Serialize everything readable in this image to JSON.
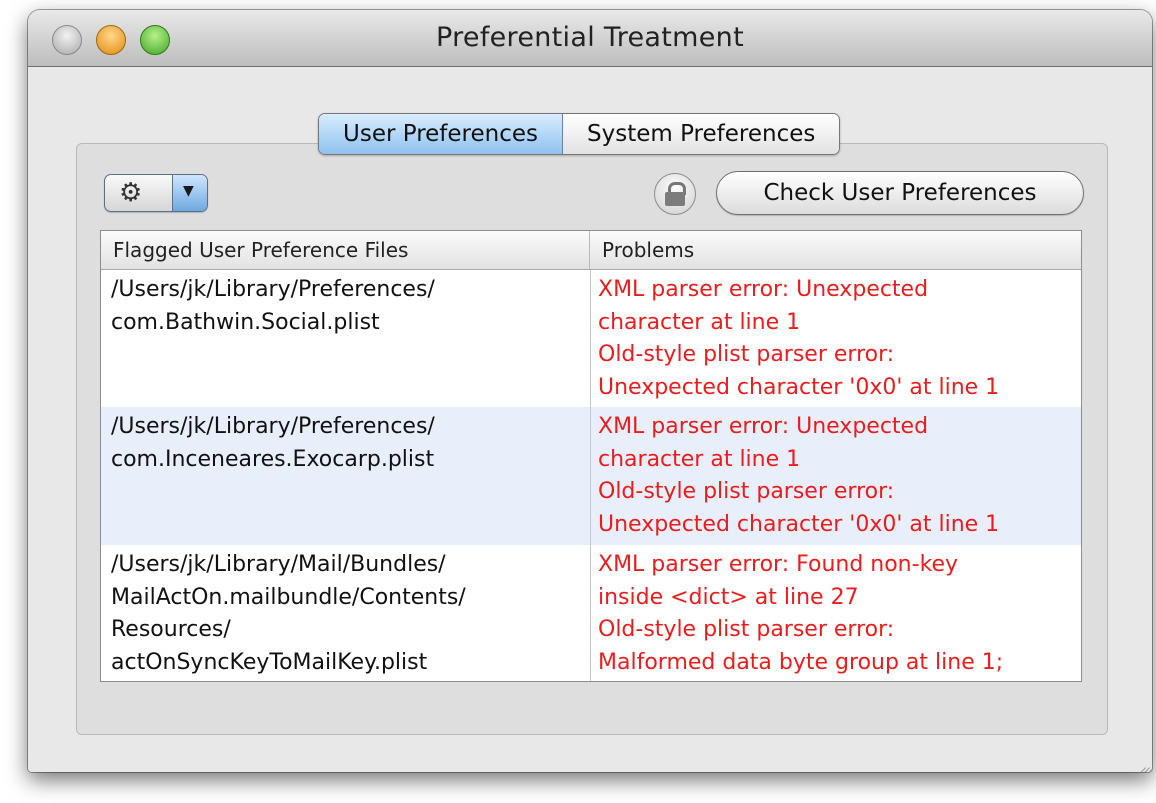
{
  "window": {
    "title": "Preferential Treatment"
  },
  "tabs": {
    "user": "User Preferences",
    "system": "System Preferences"
  },
  "toolbar": {
    "gear_icon": "gear-icon",
    "check_button_label": "Check User Preferences"
  },
  "table": {
    "headers": [
      "Flagged User Preference Files",
      "Problems"
    ],
    "rows": [
      {
        "file": "/Users/jk/Library/Preferences/\ncom.Bathwin.Social.plist",
        "problem": "XML parser error: Unexpected\ncharacter  at line 1\nOld-style plist parser error:\nUnexpected character '0x0' at line 1"
      },
      {
        "file": "/Users/jk/Library/Preferences/\ncom.Inceneares.Exocarp.plist",
        "problem": "XML parser error: Unexpected\ncharacter  at line 1\nOld-style plist parser error:\nUnexpected character '0x0' at line 1"
      },
      {
        "file": "/Users/jk/Library/Mail/Bundles/\nMailActOn.mailbundle/Contents/\nResources/\nactOnSyncKeyToMailKey.plist",
        "problem": "XML parser error: Found non-key\ninside <dict> at line 27\nOld-style plist parser error:\nMalformed data byte group at line 1;"
      }
    ]
  },
  "colors": {
    "error_text": "#ea1d1d",
    "alt_row": "#e8eefa",
    "tab_active": "#8fc2ef"
  }
}
